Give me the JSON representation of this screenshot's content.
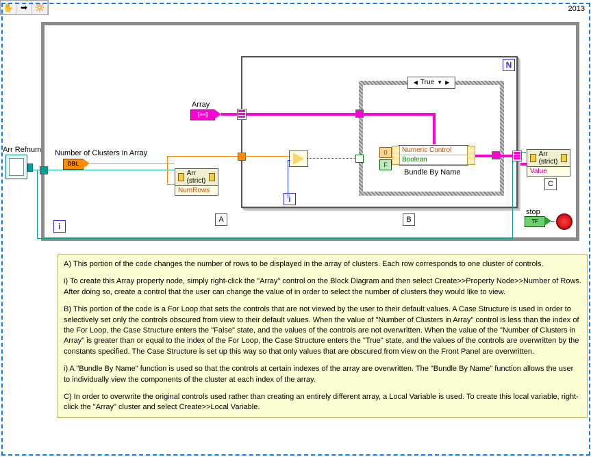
{
  "toolbar": {
    "hand": "✋",
    "arrow": "➡",
    "highlight": "🔆"
  },
  "year": "2013",
  "labels": {
    "arrRefnum": "Arr Refnum",
    "numClusters": "Number of Clusters in Array",
    "dblTag": "DBL",
    "array": "Array",
    "arrayTag": "[≡≡]",
    "caseVal": "True",
    "constNum": "0",
    "constBool": "F",
    "bundleRowNum": "Numeric Control",
    "bundleRowBool": "Boolean",
    "bundleCaption": "Bundle By Name",
    "propArrHead": "Arr (strict)",
    "propNumRows": "NumRows",
    "propValue": "Value",
    "stop": "stop",
    "stopTag": "TF",
    "A": "A",
    "B": "B",
    "C": "C",
    "N": "N",
    "i": "i",
    "iOuter": "i"
  },
  "comment": {
    "p1": "A) This portion of the code changes the number of rows to be displayed in the array of clusters. Each row corresponds to one cluster of controls.",
    "p2": "i) To create this Array property node, simply right-click the \"Array\" control on the Block Diagram and then select Create>>Property Node>>Number of Rows. After doing so, create a control that the user can change the value of in order to select the number of clusters they would like to view.",
    "p3": "B) This portion of the code is a For Loop that sets the controls that are not viewed by the user to their default values. A Case Structure is used in order to selectively set only the controls obscured from view to their default values. When the value of  \"Number of Clusters in Array\" control is less than the index of the For Loop, the Case Structure enters the \"False\" state, and the values of the controls are not overwritten. When the value of the \"Number of Clusters in Array\" is greater than or equal to the index of the For Loop, the Case Structure enters the \"True\" state, and the values of the controls are overwritten by the constants specified. The Case Structure is set up this way so that only values that are obscured from view on the Front Panel are overwritten.",
    "p4": "i) A \"Bundle By Name\" function is used so that the controls at certain indexes of the array are overwritten. The \"Bundle By Name\" function allows the user to individually view the components of the cluster at each index of the array.",
    "p5": "C) In order to overwrite the original controls used rather than creating an entirely different  array, a Local Variable is used. To create this local variable, right-click the \"Array\" cluster and select Create>>Local Variable."
  }
}
